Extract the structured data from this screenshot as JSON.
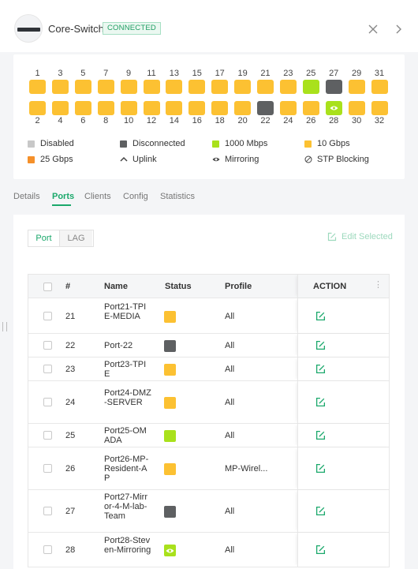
{
  "header": {
    "device_name": "Core-Switch",
    "status_badge": "CONNECTED",
    "close_icon": "close-icon",
    "next_icon": "chevron-right-icon"
  },
  "ports": {
    "top_numbers": [
      "1",
      "3",
      "5",
      "7",
      "9",
      "11",
      "13",
      "15",
      "17",
      "19",
      "21",
      "23",
      "25",
      "27",
      "29",
      "31"
    ],
    "bottom_numbers": [
      "2",
      "4",
      "6",
      "8",
      "10",
      "12",
      "14",
      "16",
      "18",
      "20",
      "22",
      "24",
      "26",
      "28",
      "30",
      "32"
    ],
    "top_status": [
      "10g",
      "10g",
      "10g",
      "10g",
      "10g",
      "10g",
      "10g",
      "10g",
      "10g",
      "10g",
      "10g",
      "10g",
      "1000m",
      "disconnected",
      "10g",
      "10g"
    ],
    "bottom_status": [
      "10g",
      "10g",
      "10g",
      "10g",
      "10g",
      "10g",
      "10g",
      "10g",
      "10g",
      "10g",
      "disconnected",
      "10g",
      "10g",
      "mirroring-1000m",
      "10g",
      "10g"
    ]
  },
  "legend": {
    "disabled": "Disabled",
    "disconnected": "Disconnected",
    "speed_1000": "1000 Mbps",
    "speed_10g": "10 Gbps",
    "speed_25g": "25 Gbps",
    "uplink": "Uplink",
    "mirroring": "Mirroring",
    "stp_blocking": "STP Blocking"
  },
  "colors": {
    "accent": "#1aa86b",
    "port_10g": "#fcc132",
    "port_1000m": "#a9e11c",
    "port_disconnected": "#5e6062",
    "port_disabled": "#c8c8c8",
    "port_25g": "#f5902a"
  },
  "tabs": {
    "details": "Details",
    "ports": "Ports",
    "clients": "Clients",
    "config": "Config",
    "statistics": "Statistics",
    "active": "Ports"
  },
  "toolbar": {
    "seg_port": "Port",
    "seg_lag": "LAG",
    "edit_selected": "Edit Selected"
  },
  "table": {
    "headers": {
      "num": "#",
      "name": "Name",
      "status": "Status",
      "profile": "Profile",
      "action": "ACTION"
    },
    "rows": [
      {
        "num": "21",
        "name": "Port21-TPIE-MEDIA",
        "status": "10g",
        "profile": "All"
      },
      {
        "num": "22",
        "name": "Port-22",
        "status": "disconnected",
        "profile": "All"
      },
      {
        "num": "23",
        "name": "Port23-TPIE",
        "status": "10g",
        "profile": "All"
      },
      {
        "num": "24",
        "name": "Port24-DMZ-SERVER",
        "status": "10g",
        "profile": "All"
      },
      {
        "num": "25",
        "name": "Port25-OMADA",
        "status": "1000m",
        "profile": "All"
      },
      {
        "num": "26",
        "name": "Port26-MP-Resident-AP",
        "status": "10g",
        "profile": "MP-Wirel..."
      },
      {
        "num": "27",
        "name": "Port27-Mirror-4-M-lab-Team",
        "status": "disconnected",
        "profile": "All"
      },
      {
        "num": "28",
        "name": "Port28-Steven-Mirroring",
        "status": "mirroring-1000m",
        "profile": "All"
      }
    ]
  }
}
